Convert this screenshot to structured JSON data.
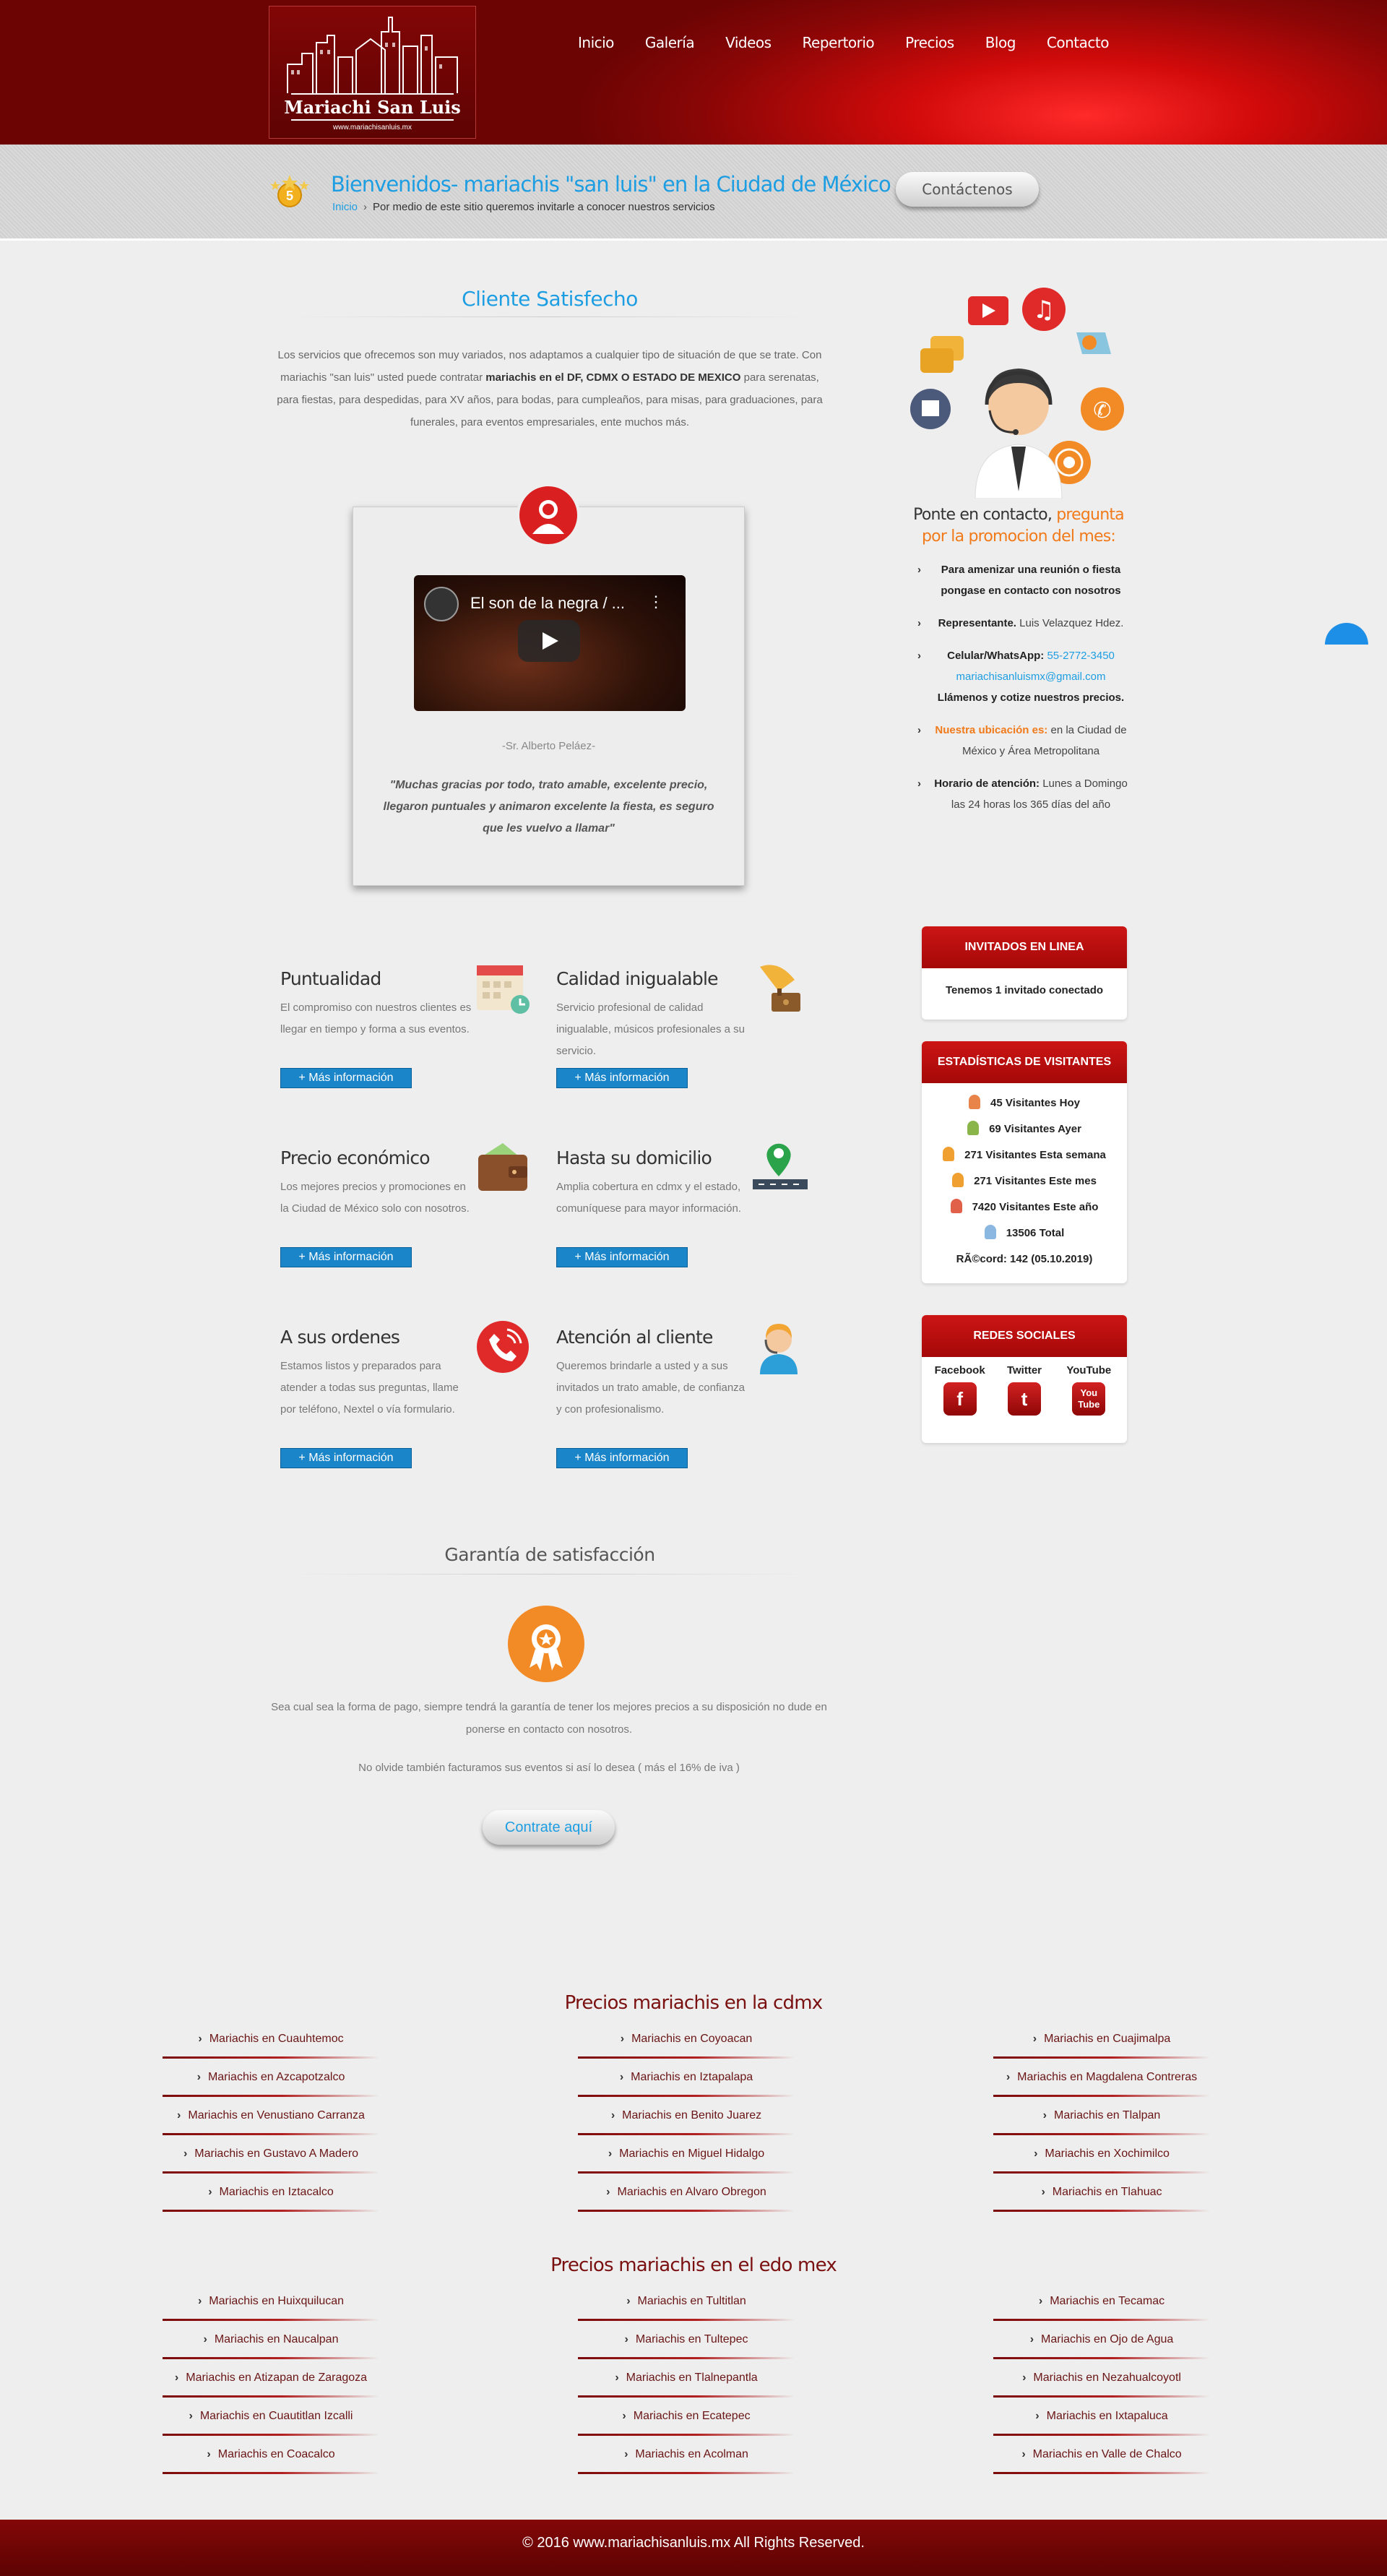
{
  "header": {
    "logo_title": "Mariachi San Luis",
    "logo_url": "www.mariachisanluis.mx",
    "nav": [
      "Inicio",
      "Galería",
      "Videos",
      "Repertorio",
      "Precios",
      "Blog",
      "Contacto"
    ]
  },
  "welcome": {
    "badge_number": "5",
    "title": "Bienvenidos- mariachis \"san luis\" en la Ciudad de México",
    "crumb_home": "Inicio",
    "crumb_text": "Por medio de este sitio queremos invitarle a conocer nuestros servicios",
    "contact_button": "Contáctenos"
  },
  "main": {
    "section_title": "Cliente Satisfecho",
    "intro_1": "Los servicios que ofrecemos son muy variados, nos adaptamos a cualquier tipo de situación de que se trate. Con mariachis \"san luis\" usted puede contratar ",
    "intro_bold": "mariachis en el DF, CDMX O ESTADO DE MEXICO",
    "intro_2": " para serenatas, para fiestas, para despedidas, para XV años, para bodas, para cumpleaños, para misas, para graduaciones, para funerales, para eventos empresariales, ente muchos más.",
    "video_title": "El son de la negra / ...",
    "testimonial_author": "-Sr. Alberto Peláez-",
    "testimonial_quote": "\"Muchas gracias por todo, trato amable, excelente precio, llegaron puntuales y animaron excelente la fiesta, es seguro que les vuelvo a llamar\"",
    "more_label": "+ Más información",
    "features": [
      {
        "title": "Puntualidad",
        "text": "El compromiso con nuestros clientes es llegar en tiempo y forma a sus eventos.",
        "icon": "calendar-icon"
      },
      {
        "title": "Calidad inigualable",
        "text": "Servicio profesional de calidad inigualable, músicos profesionales a su servicio.",
        "icon": "gramophone-icon"
      },
      {
        "title": "Precio económico",
        "text": "Los mejores precios y promociones en la Ciudad de México solo con nosotros.",
        "icon": "wallet-icon"
      },
      {
        "title": "Hasta su domicilio",
        "text": "Amplia cobertura en cdmx y el estado, comuníquese para mayor información.",
        "icon": "map-pin-icon"
      },
      {
        "title": "A sus ordenes",
        "text": "Estamos listos y preparados para atender a todas sus preguntas, llame por teléfono, Nextel o vía formulario.",
        "icon": "phone-icon"
      },
      {
        "title": "Atención al cliente",
        "text": "Queremos brindarle a usted y a sus invitados un trato amable, de confianza y con profesionalismo.",
        "icon": "operator-icon"
      }
    ],
    "guarantee_title": "Garantía de satisfacción",
    "guarantee_text": "Sea cual sea la forma de pago, siempre tendrá la garantía de tener los mejores precios a su disposición no dude en ponerse en contacto con nosotros.",
    "invoice_text": "No olvide también facturamos sus eventos si así lo desea ( más el 16% de iva )",
    "contract_button": "Contrate aquí"
  },
  "sidebar": {
    "contact_title_1": "Ponte en contacto, ",
    "contact_title_2": "pregunta por la promocion del mes:",
    "item_1": "Para amenizar una reunión o fiesta pongase en contacto con nosotros",
    "item_2_label": "Representante.",
    "item_2_value": " Luis Velazquez Hdez.",
    "item_3_label": "Celular/WhatsApp:",
    "item_3_phone": " 55-2772-3450",
    "item_3_email": "mariachisanluismx@gmail.com",
    "item_3_cta": "Llámenos y cotize nuestros precios.",
    "item_4_label": "Nuestra ubicación es:",
    "item_4_value": " en la Ciudad de México y Área Metropolitana",
    "item_5_label": "Horario de atención:",
    "item_5_value": " Lunes a Domingo las 24 horas los 365 días del año",
    "online_title": "INVITADOS EN LINEA",
    "online_text": "Tenemos 1 invitado conectado",
    "stats_title": "ESTADÍSTICAS DE VISITANTES",
    "stats": [
      {
        "text": "45 Visitantes Hoy",
        "color": "#e8834a"
      },
      {
        "text": "69 Visitantes Ayer",
        "color": "#8ab54a"
      },
      {
        "text": "271 Visitantes Esta semana",
        "color": "#f0a030"
      },
      {
        "text": "271 Visitantes Este mes",
        "color": "#f0a030"
      },
      {
        "text": "7420 Visitantes Este año",
        "color": "#e0604a"
      },
      {
        "text": "13506 Total",
        "color": "#8ab8e0"
      }
    ],
    "stats_record": "RÃ©cord: 142 (05.10.2019)",
    "social_title": "REDES SOCIALES",
    "social": [
      {
        "label": "Facebook",
        "glyph": "f"
      },
      {
        "label": "Twitter",
        "glyph": "t"
      },
      {
        "label": "YouTube",
        "glyph": "You Tube"
      }
    ]
  },
  "prices_cdmx": {
    "title": "Precios mariachis en la cdmx",
    "col1": [
      "Mariachis en Cuauhtemoc",
      "Mariachis en Azcapotzalco",
      "Mariachis en Venustiano Carranza",
      "Mariachis en Gustavo A Madero",
      "Mariachis en Iztacalco"
    ],
    "col2": [
      "Mariachis en Coyoacan",
      "Mariachis en Iztapalapa",
      "Mariachis en Benito Juarez",
      "Mariachis en Miguel Hidalgo",
      "Mariachis en Alvaro Obregon"
    ],
    "col3": [
      "Mariachis en Cuajimalpa",
      "Mariachis en Magdalena Contreras",
      "Mariachis en Tlalpan",
      "Mariachis en Xochimilco",
      "Mariachis en Tlahuac"
    ]
  },
  "prices_edomex": {
    "title": "Precios mariachis en el edo mex",
    "col1": [
      "Mariachis en Huixquilucan",
      "Mariachis en Naucalpan",
      "Mariachis en Atizapan de Zaragoza",
      "Mariachis en Cuautitlan Izcalli",
      "Mariachis en Coacalco"
    ],
    "col2": [
      "Mariachis en Tultitlan",
      "Mariachis en Tultepec",
      "Mariachis en Tlalnepantla",
      "Mariachis en Ecatepec",
      "Mariachis en Acolman"
    ],
    "col3": [
      "Mariachis en Tecamac",
      "Mariachis en Ojo de Agua",
      "Mariachis en Nezahualcoyotl",
      "Mariachis en Ixtapaluca",
      "Mariachis en Valle de Chalco"
    ]
  },
  "footer": {
    "text": "© 2016 www.mariachisanluis.mx All Rights Reserved."
  }
}
